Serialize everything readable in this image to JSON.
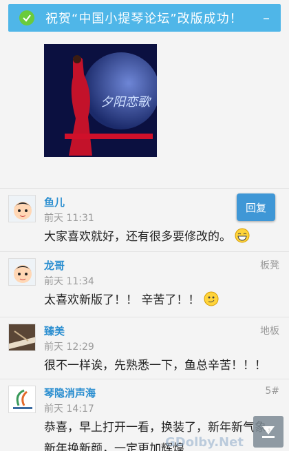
{
  "banner": {
    "text": "祝贺“中国小提琴论坛”改版成功！",
    "close": "–"
  },
  "poster": {
    "title": "夕阳恋歌"
  },
  "reply_button": "回复",
  "comments": [
    {
      "name": "鱼儿",
      "time": "前天 11:31",
      "floor": "",
      "text": "大家喜欢就好，还有很多要修改的。",
      "emoji": "grin"
    },
    {
      "name": "龙哥",
      "time": "前天 11:34",
      "floor": "板凳",
      "text": "太喜欢新版了！！  辛苦了！！",
      "emoji": "smirk"
    },
    {
      "name": "臻美",
      "time": "前天 12:29",
      "floor": "地板",
      "text": "很不一样诶，先熟悉一下，鱼总辛苦！！！"
    },
    {
      "name": "琴隐消声海",
      "time": "前天 14:17",
      "floor": "5#",
      "text": "恭喜，早上打开一看，换装了，新年新气象，新年换新颜，一定更加辉煌"
    }
  ],
  "watermark": "GDolby.Net"
}
